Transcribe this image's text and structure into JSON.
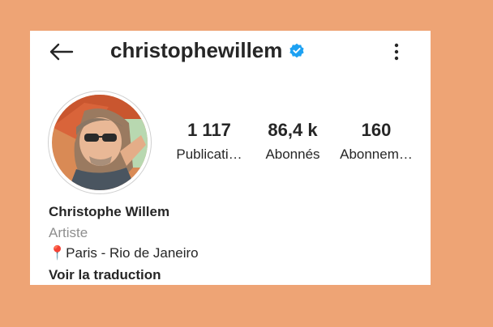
{
  "header": {
    "username": "christophewillem",
    "verified": true,
    "back_icon": "arrow-left-icon",
    "more_icon": "more-vertical-icon"
  },
  "profile": {
    "avatar_alt": "profile photo",
    "stats": [
      {
        "value": "1 117",
        "label": "Publicati…"
      },
      {
        "value": "86,4 k",
        "label": "Abonnés"
      },
      {
        "value": "160",
        "label": "Abonnem…"
      }
    ],
    "name": "Christophe Willem",
    "category": "Artiste",
    "location": "📍Paris - Rio de Janeiro",
    "translate_label": "Voir la traduction"
  },
  "colors": {
    "background": "#EEA475",
    "card": "#FFFFFF",
    "text": "#262626",
    "muted": "#8E8E8E",
    "verified": "#1DA1F2"
  }
}
